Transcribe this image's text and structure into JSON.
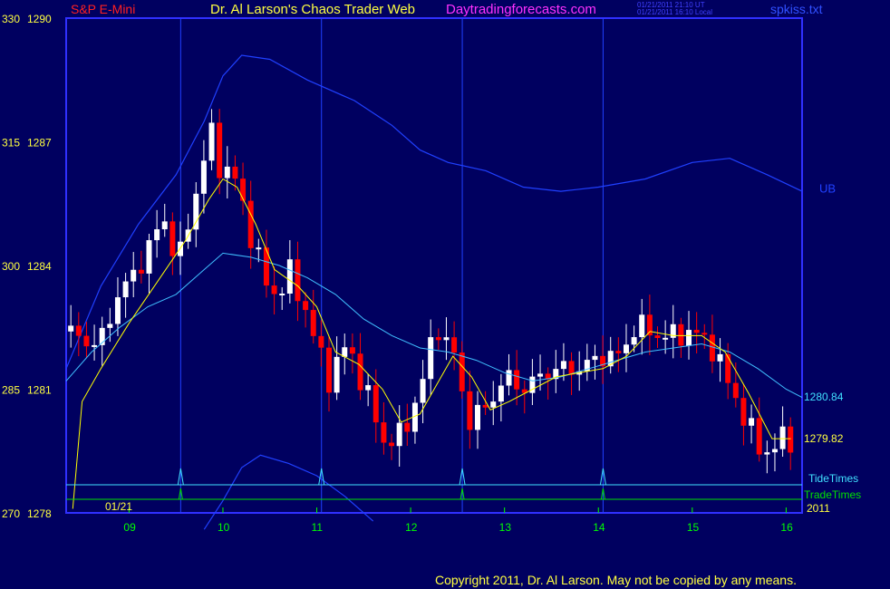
{
  "header": {
    "symbol": "S&P E-Mini",
    "title": "Dr. Al Larson's Chaos Trader Web",
    "site": "Daytradingforecasts.com",
    "stamp_line1": "01/21/2011 21:10 UT",
    "stamp_line2": "01/21/2011 16:10 Local",
    "file": "spkiss.txt"
  },
  "footer": {
    "copyright": "Copyright 2011, Dr. Al Larson. May not be copied by any means."
  },
  "colors": {
    "background": "#000060",
    "frame": "#3030ff",
    "up_candle": "#ffffff",
    "down_candle": "#ff0000",
    "fast_ma": "#ffff00",
    "slow_ma": "#40c0ff",
    "band": "#2040ff",
    "tide_line": "#40e0ff",
    "trade_line": "#00e000",
    "axis_label": "#ffff40",
    "time_label": "#00ff00"
  },
  "chart_data": {
    "type": "candlestick",
    "title": "S&P E-Mini",
    "date_label": "01/21",
    "year_label": "2011",
    "y_range": [
      1278,
      1290
    ],
    "left_scale": [
      {
        "label": "330",
        "price": 1290
      },
      {
        "label": "315",
        "price": 1287
      },
      {
        "label": "300",
        "price": 1284
      },
      {
        "label": "285",
        "price": 1281
      },
      {
        "label": "270",
        "price": 1278
      }
    ],
    "x_range_hours": [
      8.33,
      16.17
    ],
    "x_ticks": [
      "09",
      "10",
      "11",
      "12",
      "13",
      "14",
      "15",
      "16"
    ],
    "vertical_lines_hours": [
      9.55,
      11.05,
      12.55,
      14.05
    ],
    "tide_peaks_hours": [
      9.55,
      11.05,
      12.55,
      14.05
    ],
    "trade_pulses_hours": [
      9.55,
      12.55,
      14.05
    ],
    "band_label": "UB",
    "right_labels": [
      {
        "text": "1280.84",
        "price": 1280.84,
        "color": "#40e0ff"
      },
      {
        "text": "1279.82",
        "price": 1279.82,
        "color": "#ffff40"
      }
    ],
    "legend": [
      {
        "name": "TideTimes",
        "color": "#40e0ff"
      },
      {
        "name": "TradeTimes",
        "color": "#00e000"
      }
    ],
    "price_path": [
      {
        "h": 8.38,
        "p": 1282.4
      },
      {
        "h": 8.55,
        "p": 1282.3
      },
      {
        "h": 8.75,
        "p": 1282.0
      },
      {
        "h": 8.95,
        "p": 1283.2
      },
      {
        "h": 9.25,
        "p": 1284.2
      },
      {
        "h": 9.45,
        "p": 1285.2
      },
      {
        "h": 9.6,
        "p": 1284.0
      },
      {
        "h": 9.8,
        "p": 1285.8
      },
      {
        "h": 9.95,
        "p": 1287.3
      },
      {
        "h": 10.05,
        "p": 1286.4
      },
      {
        "h": 10.2,
        "p": 1286.2
      },
      {
        "h": 10.4,
        "p": 1284.6
      },
      {
        "h": 10.6,
        "p": 1283.2
      },
      {
        "h": 10.8,
        "p": 1283.8
      },
      {
        "h": 11.0,
        "p": 1282.7
      },
      {
        "h": 11.2,
        "p": 1281.2
      },
      {
        "h": 11.4,
        "p": 1282.1
      },
      {
        "h": 11.6,
        "p": 1281.0
      },
      {
        "h": 11.8,
        "p": 1279.7
      },
      {
        "h": 12.0,
        "p": 1279.9
      },
      {
        "h": 12.2,
        "p": 1281.1
      },
      {
        "h": 12.35,
        "p": 1282.6
      },
      {
        "h": 12.55,
        "p": 1281.8
      },
      {
        "h": 12.7,
        "p": 1280.2
      },
      {
        "h": 12.9,
        "p": 1280.6
      },
      {
        "h": 13.1,
        "p": 1281.3
      },
      {
        "h": 13.3,
        "p": 1281.0
      },
      {
        "h": 13.5,
        "p": 1281.4
      },
      {
        "h": 13.7,
        "p": 1281.5
      },
      {
        "h": 13.9,
        "p": 1281.5
      },
      {
        "h": 14.1,
        "p": 1281.8
      },
      {
        "h": 14.3,
        "p": 1281.8
      },
      {
        "h": 14.5,
        "p": 1282.6
      },
      {
        "h": 14.7,
        "p": 1282.3
      },
      {
        "h": 14.9,
        "p": 1282.3
      },
      {
        "h": 15.1,
        "p": 1282.4
      },
      {
        "h": 15.3,
        "p": 1282.0
      },
      {
        "h": 15.5,
        "p": 1281.0
      },
      {
        "h": 15.7,
        "p": 1280.0
      },
      {
        "h": 15.85,
        "p": 1279.4
      },
      {
        "h": 16.05,
        "p": 1279.8
      }
    ],
    "fast_ma_path": [
      {
        "h": 8.4,
        "p": 1278.1
      },
      {
        "h": 8.5,
        "p": 1280.7
      },
      {
        "h": 8.7,
        "p": 1281.5
      },
      {
        "h": 9.0,
        "p": 1282.6
      },
      {
        "h": 9.3,
        "p": 1283.6
      },
      {
        "h": 9.6,
        "p": 1284.6
      },
      {
        "h": 9.85,
        "p": 1285.6
      },
      {
        "h": 10.0,
        "p": 1286.1
      },
      {
        "h": 10.15,
        "p": 1285.9
      },
      {
        "h": 10.35,
        "p": 1285.0
      },
      {
        "h": 10.55,
        "p": 1283.9
      },
      {
        "h": 10.8,
        "p": 1283.5
      },
      {
        "h": 11.0,
        "p": 1283.0
      },
      {
        "h": 11.2,
        "p": 1281.9
      },
      {
        "h": 11.45,
        "p": 1281.6
      },
      {
        "h": 11.7,
        "p": 1281.0
      },
      {
        "h": 11.9,
        "p": 1280.2
      },
      {
        "h": 12.1,
        "p": 1280.4
      },
      {
        "h": 12.3,
        "p": 1281.2
      },
      {
        "h": 12.45,
        "p": 1281.8
      },
      {
        "h": 12.65,
        "p": 1281.3
      },
      {
        "h": 12.85,
        "p": 1280.5
      },
      {
        "h": 13.05,
        "p": 1280.7
      },
      {
        "h": 13.3,
        "p": 1281.0
      },
      {
        "h": 13.55,
        "p": 1281.3
      },
      {
        "h": 13.8,
        "p": 1281.4
      },
      {
        "h": 14.05,
        "p": 1281.5
      },
      {
        "h": 14.3,
        "p": 1281.8
      },
      {
        "h": 14.55,
        "p": 1282.4
      },
      {
        "h": 14.8,
        "p": 1282.3
      },
      {
        "h": 15.1,
        "p": 1282.3
      },
      {
        "h": 15.35,
        "p": 1281.9
      },
      {
        "h": 15.6,
        "p": 1280.9
      },
      {
        "h": 15.85,
        "p": 1279.8
      },
      {
        "h": 16.05,
        "p": 1279.8
      }
    ],
    "slow_ma_path": [
      {
        "h": 8.33,
        "p": 1281.2
      },
      {
        "h": 8.6,
        "p": 1281.9
      },
      {
        "h": 8.9,
        "p": 1282.5
      },
      {
        "h": 9.2,
        "p": 1283.0
      },
      {
        "h": 9.5,
        "p": 1283.3
      },
      {
        "h": 9.8,
        "p": 1283.9
      },
      {
        "h": 10.0,
        "p": 1284.3
      },
      {
        "h": 10.3,
        "p": 1284.2
      },
      {
        "h": 10.6,
        "p": 1284.0
      },
      {
        "h": 10.9,
        "p": 1283.7
      },
      {
        "h": 11.2,
        "p": 1283.3
      },
      {
        "h": 11.5,
        "p": 1282.7
      },
      {
        "h": 11.8,
        "p": 1282.3
      },
      {
        "h": 12.1,
        "p": 1282.0
      },
      {
        "h": 12.4,
        "p": 1281.9
      },
      {
        "h": 12.7,
        "p": 1281.7
      },
      {
        "h": 13.0,
        "p": 1281.4
      },
      {
        "h": 13.3,
        "p": 1281.2
      },
      {
        "h": 13.6,
        "p": 1281.3
      },
      {
        "h": 13.9,
        "p": 1281.5
      },
      {
        "h": 14.2,
        "p": 1281.7
      },
      {
        "h": 14.5,
        "p": 1281.9
      },
      {
        "h": 14.8,
        "p": 1282.0
      },
      {
        "h": 15.1,
        "p": 1282.1
      },
      {
        "h": 15.4,
        "p": 1281.9
      },
      {
        "h": 15.7,
        "p": 1281.5
      },
      {
        "h": 16.0,
        "p": 1281.0
      },
      {
        "h": 16.17,
        "p": 1280.8
      }
    ],
    "upper_band_path": [
      {
        "h": 8.33,
        "p": 1281.5
      },
      {
        "h": 8.7,
        "p": 1283.5
      },
      {
        "h": 9.1,
        "p": 1285.0
      },
      {
        "h": 9.5,
        "p": 1286.2
      },
      {
        "h": 9.8,
        "p": 1287.5
      },
      {
        "h": 10.0,
        "p": 1288.6
      },
      {
        "h": 10.2,
        "p": 1289.1
      },
      {
        "h": 10.5,
        "p": 1289.0
      },
      {
        "h": 10.9,
        "p": 1288.5
      },
      {
        "h": 11.4,
        "p": 1288.0
      },
      {
        "h": 11.8,
        "p": 1287.4
      },
      {
        "h": 12.1,
        "p": 1286.8
      },
      {
        "h": 12.4,
        "p": 1286.5
      },
      {
        "h": 12.8,
        "p": 1286.3
      },
      {
        "h": 13.2,
        "p": 1285.9
      },
      {
        "h": 13.6,
        "p": 1285.8
      },
      {
        "h": 14.0,
        "p": 1285.9
      },
      {
        "h": 14.5,
        "p": 1286.1
      },
      {
        "h": 15.0,
        "p": 1286.5
      },
      {
        "h": 15.4,
        "p": 1286.6
      },
      {
        "h": 15.8,
        "p": 1286.2
      },
      {
        "h": 16.17,
        "p": 1285.8
      }
    ],
    "lower_band_path": [
      {
        "h": 9.8,
        "p": 1277.6
      },
      {
        "h": 10.0,
        "p": 1278.3
      },
      {
        "h": 10.2,
        "p": 1279.1
      },
      {
        "h": 10.4,
        "p": 1279.4
      },
      {
        "h": 10.7,
        "p": 1279.2
      },
      {
        "h": 11.0,
        "p": 1278.9
      },
      {
        "h": 11.3,
        "p": 1278.4
      },
      {
        "h": 11.6,
        "p": 1277.8
      }
    ]
  }
}
